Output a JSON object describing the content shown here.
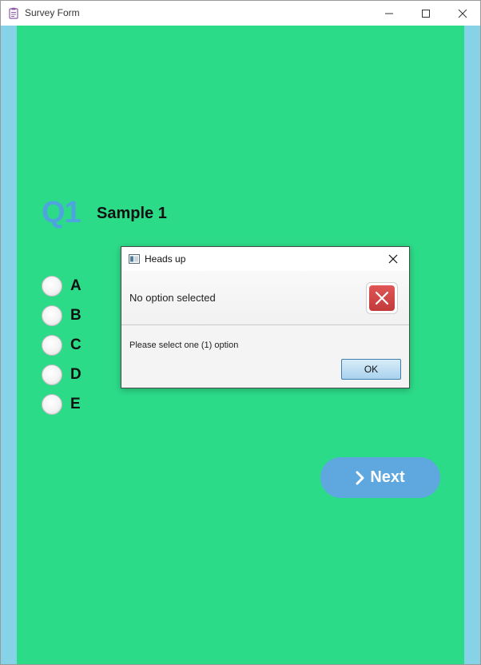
{
  "window": {
    "title": "Survey Form",
    "app_icon": "clipboard-icon",
    "controls": [
      "minimize-icon",
      "maximize-icon",
      "close-icon"
    ]
  },
  "question": {
    "number": "Q1",
    "text": "Sample 1",
    "options": [
      "A",
      "B",
      "C",
      "D",
      "E"
    ],
    "selected": null
  },
  "next_button": {
    "label": "Next",
    "icon": "chevron-right-icon"
  },
  "dialog": {
    "title": "Heads up",
    "header": "No option selected",
    "message": "Please select one (1) option",
    "ok_label": "OK",
    "icon": "error-icon"
  },
  "colors": {
    "panel_bg": "#2cdb88",
    "side_bg": "#86d3e7",
    "accent_blue": "#5ea7df",
    "qnum_blue": "#4ea5de",
    "error_red": "#d04a4a"
  }
}
